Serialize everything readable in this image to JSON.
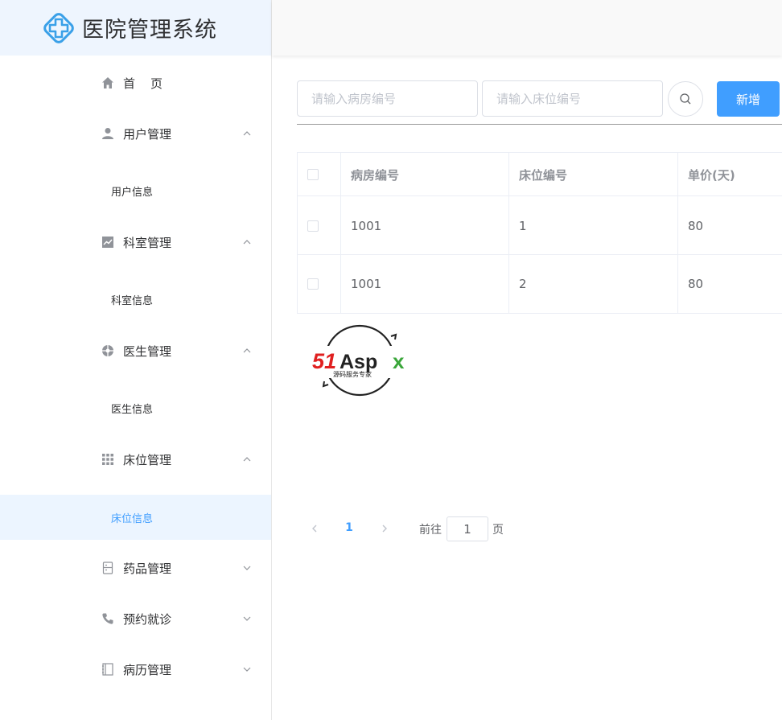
{
  "app": {
    "title": "医院管理系统"
  },
  "sidebar": {
    "menu": [
      {
        "label": "首　页",
        "icon": "home-icon",
        "expanded": null
      },
      {
        "label": "用户管理",
        "icon": "user-icon",
        "expanded": true,
        "sub": "用户信息"
      },
      {
        "label": "科室管理",
        "icon": "chart-icon",
        "expanded": true,
        "sub": "科室信息"
      },
      {
        "label": "医生管理",
        "icon": "doctor-icon",
        "expanded": true,
        "sub": "医生信息"
      },
      {
        "label": "床位管理",
        "icon": "grid-icon",
        "expanded": true,
        "sub": "床位信息"
      },
      {
        "label": "药品管理",
        "icon": "medicine-icon",
        "expanded": false
      },
      {
        "label": "预约就诊",
        "icon": "phone-icon",
        "expanded": false
      },
      {
        "label": "病历管理",
        "icon": "notebook-icon",
        "expanded": false
      }
    ],
    "active_sub": "床位信息"
  },
  "toolbar": {
    "ward_placeholder": "请输入病房编号",
    "bed_placeholder": "请输入床位编号",
    "add_label": "新增"
  },
  "table": {
    "headers": [
      "病房编号",
      "床位编号",
      "单价(天)"
    ],
    "rows": [
      [
        "1001",
        "1",
        "80"
      ],
      [
        "1001",
        "2",
        "80"
      ]
    ]
  },
  "watermark": {
    "brand": "51Aspx",
    "tagline": "源码服务专家"
  },
  "pagination": {
    "current": "1",
    "goto_prefix": "前往",
    "goto_value": "1",
    "goto_suffix": "页"
  },
  "colors": {
    "primary": "#409eff",
    "active_bg": "#ecf5ff",
    "logo_bg": "#eef5fe"
  }
}
